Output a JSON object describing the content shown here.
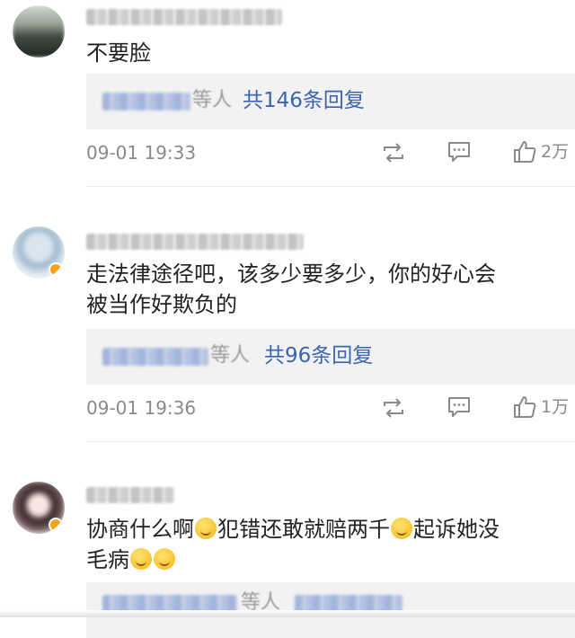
{
  "comments": [
    {
      "text_lines": [
        "不要脸"
      ],
      "reply_suffix": "等人",
      "reply_total": "共146条回复",
      "timestamp": "09-01 19:33",
      "likes": "2万"
    },
    {
      "text_lines": [
        "走法律途径吧，该多少要多少，你的好心会",
        "被当作好欺负的"
      ],
      "reply_suffix": "等人",
      "reply_total": "共96条回复",
      "timestamp": "09-01 19:36",
      "likes": "1万"
    },
    {
      "text_parts": [
        "协商什么啊",
        "犯错还敢就赔两千",
        "起诉她没"
      ],
      "text_line2": "毛病",
      "reply_suffix": "等人"
    }
  ],
  "icons": {
    "repost": "repost-icon",
    "comment": "comment-icon",
    "like": "thumbs-up-icon",
    "verified": "verified-badge-icon",
    "emoji": "grin-emoji-icon"
  },
  "colors": {
    "link_blue": "#3b65b3",
    "meta_gray": "#8a8a8a",
    "reply_bg": "#f2f2f2",
    "verified_orange": "#f2a416"
  }
}
